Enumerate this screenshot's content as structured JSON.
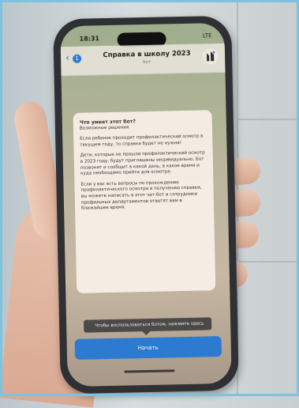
{
  "status_bar": {
    "time": "18:31",
    "indicators": "LTE"
  },
  "chat": {
    "back_label": "‹",
    "unread_count": "1",
    "title": "Справка в школу 2023",
    "subtitle": "бот",
    "avatar_icon": "bot-avatar-icon"
  },
  "bubble": {
    "question": "Что умеет этот бот?",
    "answer_intro": "Возможные решения",
    "paragraphs": [
      "Если ребенок проходит профилактический осмотр в текущем году, то справка будет не нужна!",
      "Дети, которые не прошли профилактический осмотр в 2023 году, будут приглашены индивидуально. Бот позвонит и сообщит в какой день, в какое время и куда необходимо прийти для осмотра.",
      "Если у вас есть вопросы по прохождению профилактического осмотра и получению справки, вы можете написать в этот чат-бот и сотрудники профильных департаментов ответят вам в ближайшее время."
    ]
  },
  "tooltip": {
    "text": "Чтобы воспользоваться ботом, нажмите здесь"
  },
  "start_button": {
    "label": "Начать"
  },
  "colors": {
    "accent": "#2d7ad1",
    "frame": "#7ec3de"
  }
}
